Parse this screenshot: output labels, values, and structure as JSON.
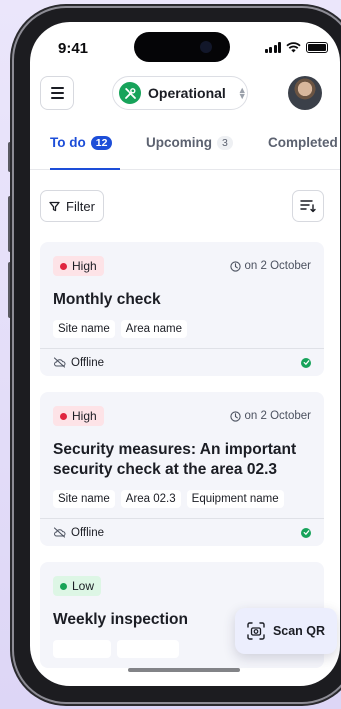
{
  "status_bar": {
    "time": "9:41"
  },
  "header": {
    "status_label": "Operational",
    "status_color": "#17a35a"
  },
  "tabs": [
    {
      "label": "To do",
      "count": "12",
      "active": true
    },
    {
      "label": "Upcoming",
      "count": "3",
      "active": false
    },
    {
      "label": "Completed",
      "count": "",
      "active": false
    }
  ],
  "toolbar": {
    "filter_label": "Filter"
  },
  "tasks": [
    {
      "priority": "High",
      "due": "on 2 October",
      "title": "Monthly check",
      "tags": [
        "Site name",
        "Area name"
      ],
      "connection": "Offline"
    },
    {
      "priority": "High",
      "due": "on 2 October",
      "title": "Security measures: An important security check at the area 02.3",
      "tags": [
        "Site name",
        "Area 02.3",
        "Equipment name"
      ],
      "connection": "Offline"
    },
    {
      "priority": "Low",
      "title": "Weekly inspection"
    }
  ],
  "fab": {
    "label": "Scan QR"
  },
  "colors": {
    "accent": "#1d4ed8",
    "high": "#e0253f",
    "low": "#18a356"
  }
}
